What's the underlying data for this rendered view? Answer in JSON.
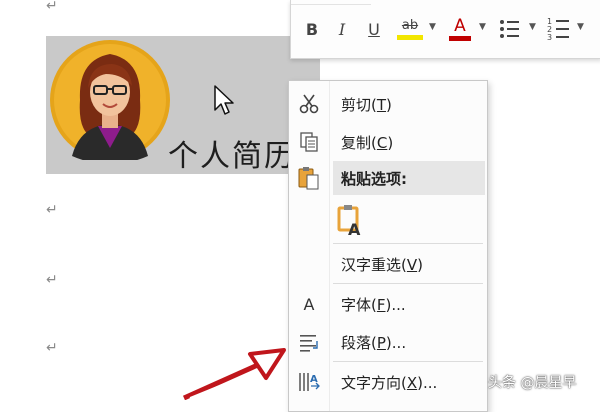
{
  "document": {
    "heading": "个人简历",
    "paragraph_mark": "↵"
  },
  "mini_toolbar": {
    "bold": "B",
    "italic": "I",
    "underline": "U",
    "highlight_text": "ab",
    "font_color_letter": "A",
    "highlight_color": "#f2e600",
    "font_color": "#c00000"
  },
  "context_menu": {
    "items": [
      {
        "label": "剪切",
        "shortcut": "T",
        "icon": "scissors-icon"
      },
      {
        "label": "复制",
        "shortcut": "C",
        "icon": "copy-icon"
      },
      {
        "label": "粘贴选项:",
        "shortcut": "",
        "icon": "clipboard-icon"
      },
      {
        "label": "",
        "shortcut": "",
        "icon": "paste-keep-text-icon"
      },
      {
        "label": "汉字重选",
        "shortcut": "V",
        "icon": ""
      },
      {
        "label": "字体",
        "shortcut": "F",
        "suffix": "...",
        "icon": "font-icon"
      },
      {
        "label": "段落",
        "shortcut": "P",
        "suffix": "...",
        "icon": "paragraph-icon"
      },
      {
        "label": "文字方向",
        "shortcut": "X",
        "suffix": "...",
        "icon": "text-direction-icon"
      }
    ],
    "paste_glyph": "A",
    "font_glyph": "A"
  },
  "watermark": "头条 @晨星早",
  "colors": {
    "selection": "#c9c9c9",
    "arrow": "#c0161c",
    "avatar_bg": "#e5a41a"
  }
}
